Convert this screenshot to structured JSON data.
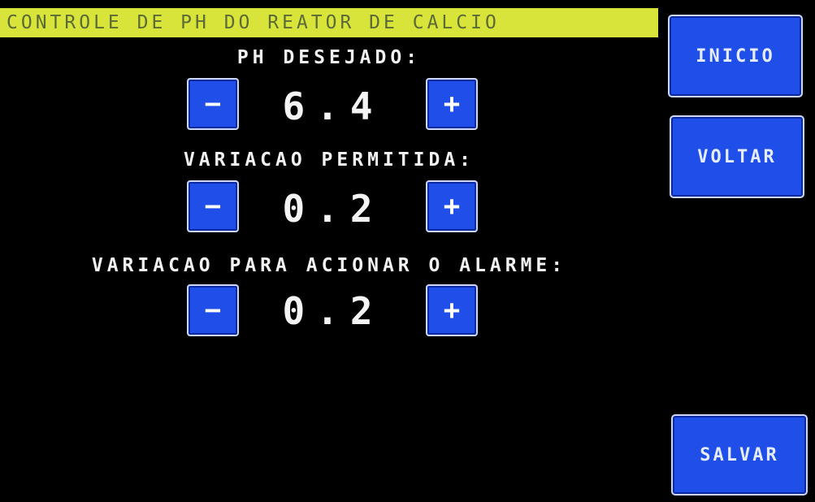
{
  "header": {
    "title": "CONTROLE DE PH DO REATOR DE CALCIO"
  },
  "settings": [
    {
      "label": "PH DESEJADO:",
      "value": "6.4",
      "minus": "−",
      "plus": "+"
    },
    {
      "label": "VARIACAO PERMITIDA:",
      "value": "0.2",
      "minus": "−",
      "plus": "+"
    },
    {
      "label": "VARIACAO PARA ACIONAR O ALARME:",
      "value": "0.2",
      "minus": "−",
      "plus": "+"
    }
  ],
  "nav": {
    "inicio": "INICIO",
    "voltar": "VOLTAR",
    "salvar": "SALVAR"
  },
  "colors": {
    "background": "#000000",
    "title_bar": "#d8e43a",
    "button": "#1f4fe8",
    "text": "#f2f2f2"
  }
}
